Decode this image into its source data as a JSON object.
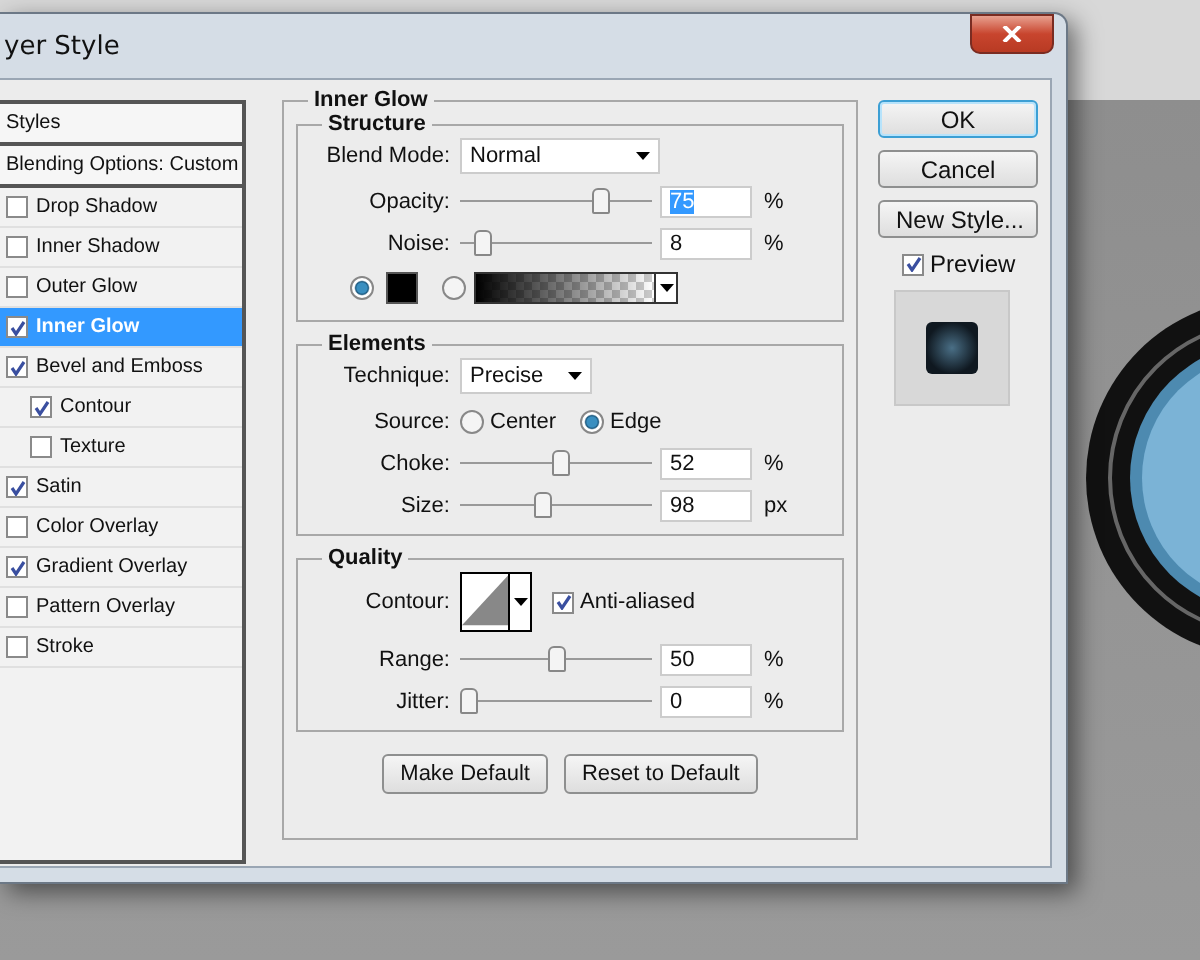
{
  "window": {
    "title": "yer Style"
  },
  "styles_list": [
    {
      "kind": "heading",
      "label": "Styles",
      "selected": false
    },
    {
      "kind": "heading",
      "label": "Blending Options: Custom",
      "selected": false
    },
    {
      "kind": "option",
      "label": "Drop Shadow",
      "checked": false,
      "selected": false
    },
    {
      "kind": "option",
      "label": "Inner Shadow",
      "checked": false,
      "selected": false
    },
    {
      "kind": "option",
      "label": "Outer Glow",
      "checked": false,
      "selected": false
    },
    {
      "kind": "option",
      "label": "Inner Glow",
      "checked": true,
      "selected": true
    },
    {
      "kind": "option",
      "label": "Bevel and Emboss",
      "checked": true,
      "selected": false,
      "children": [
        {
          "kind": "option",
          "label": "Contour",
          "checked": true,
          "selected": false
        },
        {
          "kind": "option",
          "label": "Texture",
          "checked": false,
          "selected": false
        }
      ]
    },
    {
      "kind": "option",
      "label": "Satin",
      "checked": true,
      "selected": false
    },
    {
      "kind": "option",
      "label": "Color Overlay",
      "checked": false,
      "selected": false
    },
    {
      "kind": "option",
      "label": "Gradient Overlay",
      "checked": true,
      "selected": false
    },
    {
      "kind": "option",
      "label": "Pattern Overlay",
      "checked": false,
      "selected": false
    },
    {
      "kind": "option",
      "label": "Stroke",
      "checked": false,
      "selected": false
    }
  ],
  "panel": {
    "title": "Inner Glow",
    "sections": [
      {
        "title": "Structure",
        "rows": [
          {
            "kind": "dropdown",
            "label": "Blend Mode:",
            "value": "Normal"
          },
          {
            "kind": "slider",
            "label": "Opacity:",
            "level": 0.75,
            "value": "75",
            "unit": "%",
            "highlighted": true
          },
          {
            "kind": "slider",
            "label": "Noise:",
            "level": 0.08,
            "value": "8",
            "unit": "%",
            "highlighted": false
          },
          {
            "kind": "fill",
            "options": [
              {
                "kind": "color",
                "selected": true
              },
              {
                "kind": "gradient",
                "selected": false
              }
            ]
          }
        ]
      },
      {
        "title": "Elements",
        "rows": [
          {
            "kind": "dropdown",
            "label": "Technique:",
            "value": "Precise"
          },
          {
            "kind": "radio",
            "label": "Source:",
            "options": [
              {
                "label": "Center",
                "selected": false
              },
              {
                "label": "Edge",
                "selected": true
              }
            ]
          },
          {
            "kind": "slider",
            "label": "Choke:",
            "level": 0.52,
            "value": "52",
            "unit": "%",
            "highlighted": false
          },
          {
            "kind": "slider",
            "label": "Size:",
            "level": 0.42,
            "value": "98",
            "unit": "px",
            "highlighted": false
          }
        ]
      },
      {
        "title": "Quality",
        "rows": [
          {
            "kind": "contour",
            "label": "Contour:",
            "checkbox": {
              "label": "Anti-aliased",
              "checked": true
            }
          },
          {
            "kind": "slider",
            "label": "Range:",
            "level": 0.5,
            "value": "50",
            "unit": "%",
            "highlighted": false
          },
          {
            "kind": "slider",
            "label": "Jitter:",
            "level": 0,
            "value": "0",
            "unit": "%",
            "highlighted": false
          }
        ]
      }
    ],
    "buttons": [
      "Make Default",
      "Reset to Default"
    ]
  },
  "side_buttons": [
    {
      "label": "OK",
      "default": true
    },
    {
      "label": "Cancel",
      "default": false
    },
    {
      "label": "New Style...",
      "default": false
    }
  ],
  "preview": {
    "label": "Preview",
    "checked": true
  }
}
